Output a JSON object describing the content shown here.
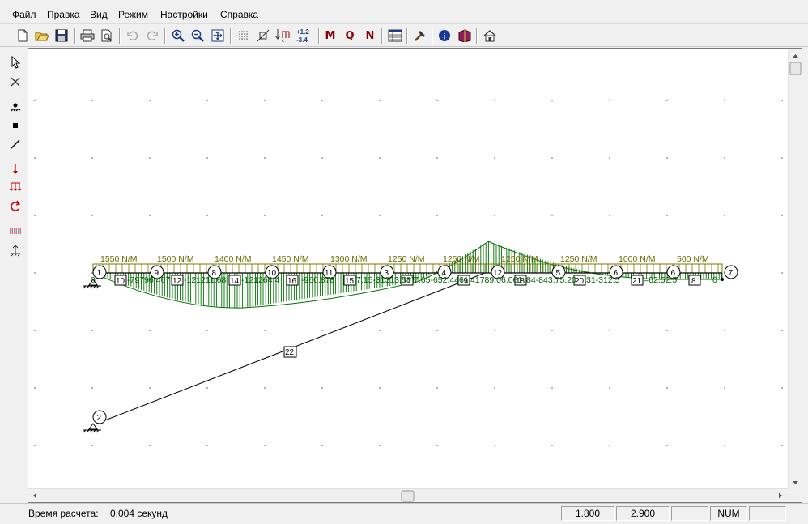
{
  "menu": {
    "items": [
      "Файл",
      "Правка",
      "Вид",
      "Режим",
      "Настройки",
      "Справка"
    ]
  },
  "toolbar": {
    "buttons": [
      "new-file-icon",
      "open-folder-icon",
      "save-icon",
      "print-icon",
      "print-preview-icon",
      "undo-icon",
      "redo-icon",
      "zoom-in-icon",
      "zoom-out-icon",
      "zoom-fit-icon",
      "grid-icon",
      "snap-icon",
      "values-icon",
      "numbers-icon",
      "moment-M",
      "shear-Q",
      "normal-N",
      "table-icon",
      "hammer-icon",
      "info-icon",
      "book-icon",
      "home-icon"
    ],
    "moment_label": "M",
    "shear_label": "Q",
    "normal_label": "N",
    "numbers_label_top": "+1.2",
    "numbers_label_bottom": "-3.4"
  },
  "colors": {
    "load": "#7a7a00",
    "diagram": "#007000",
    "annotation": "#006000",
    "structure": "#000000"
  },
  "loads": [
    "1550 N/M",
    "1500 N/M",
    "1400 N/M",
    "1450 N/M",
    "1300 N/M",
    "1250 N/M",
    "1250 N/M",
    "1250 N/M",
    "1250 N/M",
    "1000 N/M",
    "500 N/M"
  ],
  "nodes": {
    "n1": "1",
    "n9": "9",
    "n8": "8",
    "n10": "10",
    "n11": "11",
    "n3": "3",
    "n4": "4",
    "n12": "12",
    "n5": "5",
    "n6": "6",
    "n7": "7",
    "n2": "2"
  },
  "elements": {
    "e10": "10",
    "e12": "12",
    "e14": "14",
    "e16": "16",
    "e15": "15",
    "e17": "17",
    "e19": "19",
    "e18": "18",
    "e20": "20",
    "e21": "21",
    "e8": "8",
    "e22": "22"
  },
  "diagram_values": {
    "v0": "0",
    "seg1": "-79796.467",
    "seg2": "-121211.68",
    "seg3": "-121264.4",
    "seg4": "-960.878",
    "seg5": "7.15-31313.587",
    "seg6": "7.65-652.4461",
    "seg7": "41789.06.061",
    "seg8": "84-843.75.20",
    "seg9": "31-312.5",
    "seg10": "=62.52.5",
    "vend": "0"
  },
  "status": {
    "label": "Время расчета:",
    "value": "0.004 секунд",
    "x": "1.800",
    "y": "2.900",
    "num": "NUM"
  }
}
